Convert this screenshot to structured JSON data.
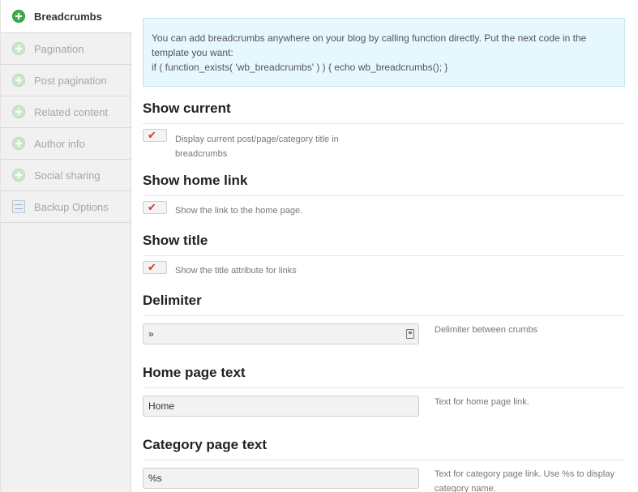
{
  "sidebar": {
    "items": [
      {
        "label": "Breadcrumbs",
        "icon": "plus-circle-icon"
      },
      {
        "label": "Pagination",
        "icon": "plus-circle-icon"
      },
      {
        "label": "Post pagination",
        "icon": "plus-circle-icon"
      },
      {
        "label": "Related content",
        "icon": "plus-circle-icon"
      },
      {
        "label": "Author info",
        "icon": "plus-circle-icon"
      },
      {
        "label": "Social sharing",
        "icon": "plus-circle-icon"
      },
      {
        "label": "Backup Options",
        "icon": "list-icon"
      }
    ]
  },
  "notice": {
    "line1": "You can add breadcrumbs anywhere on your blog by calling function directly. Put the next code in the template you want:",
    "code": "if ( function_exists( 'wb_breadcrumbs' ) ) { echo wb_breadcrumbs(); }"
  },
  "options": {
    "show_current": {
      "title": "Show current",
      "desc": "Display current post/page/category title in breadcrumbs",
      "checked": true
    },
    "show_home_link": {
      "title": "Show home link",
      "desc": "Show the link to the home page.",
      "checked": true
    },
    "show_title": {
      "title": "Show title",
      "desc": "Show the title attribute for links",
      "checked": true
    },
    "delimiter": {
      "title": "Delimiter",
      "value": "»",
      "desc": "Delimiter between crumbs"
    },
    "home_page_text": {
      "title": "Home page text",
      "value": "Home",
      "desc": "Text for home page link."
    },
    "category_page_text": {
      "title": "Category page text",
      "value": "%s",
      "desc": "Text for category page link. Use %s to display category name."
    }
  },
  "colors": {
    "accent_green": "#3fae4a",
    "notice_bg": "#e6f7fd",
    "check_red": "#d9342b"
  }
}
